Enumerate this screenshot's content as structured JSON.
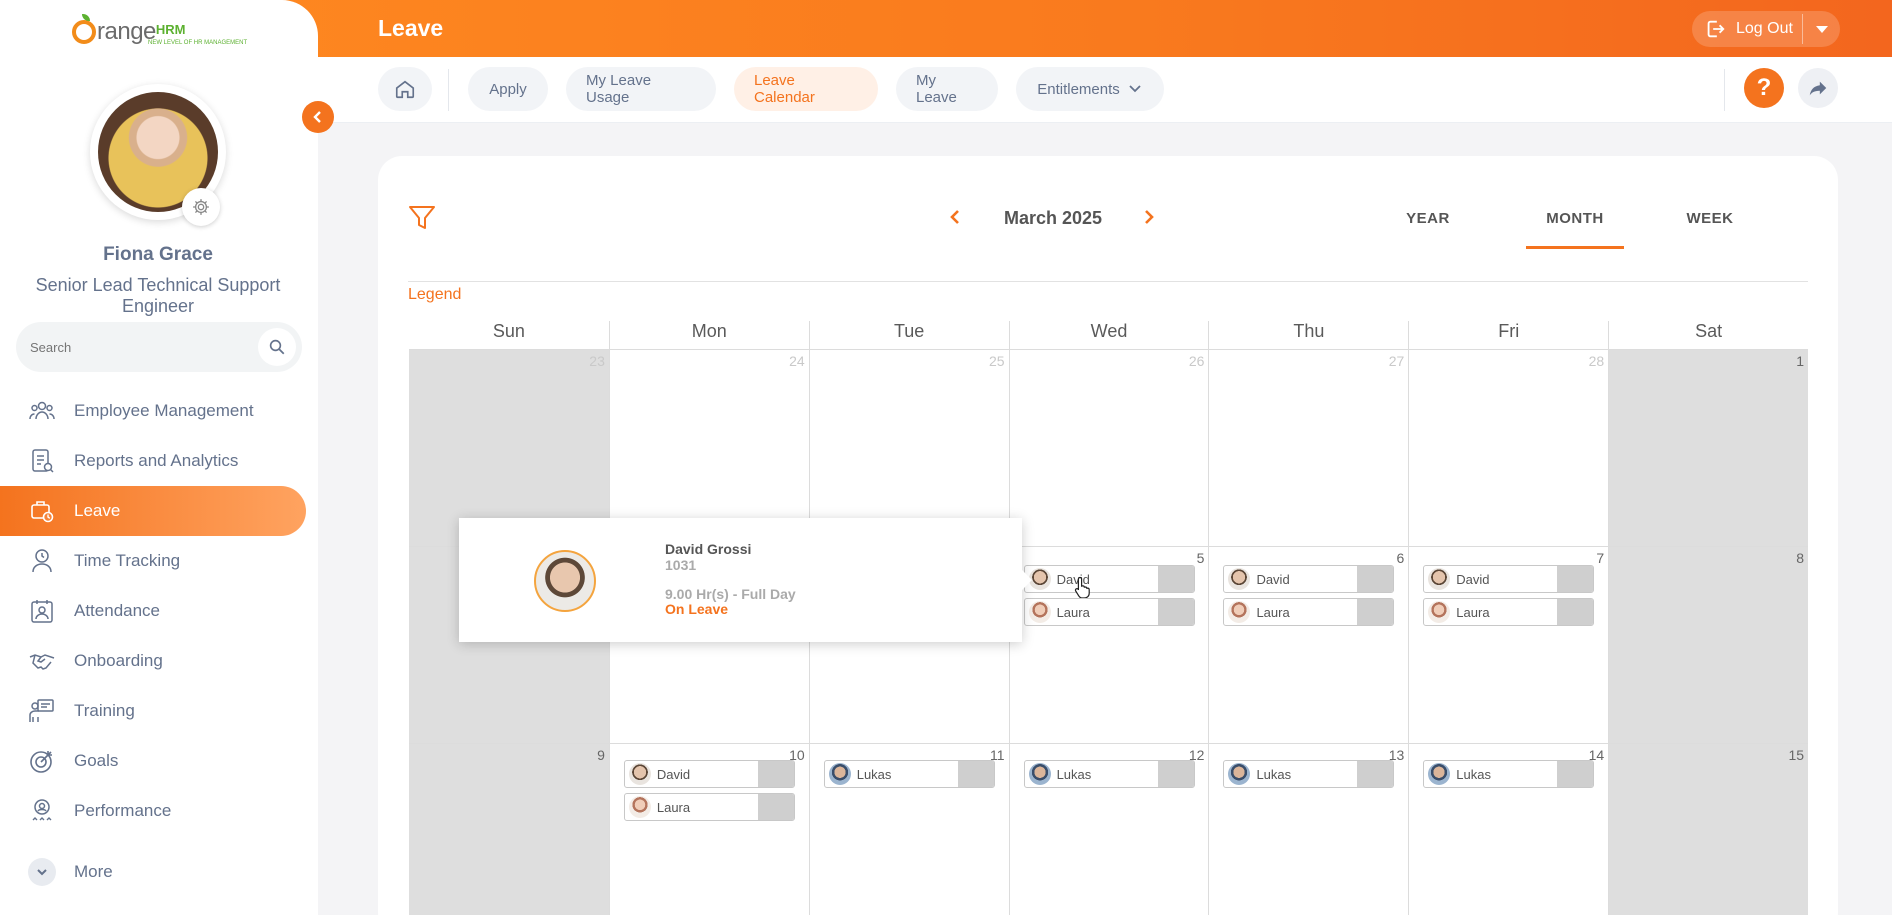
{
  "header": {
    "title": "Leave",
    "logout_label": "Log Out"
  },
  "brand": {
    "logo_text": "range",
    "logo_hrm": "HRM",
    "tagline": "NEW LEVEL OF HR MANAGEMENT"
  },
  "user": {
    "name": "Fiona Grace",
    "title": "Senior Lead Technical Support Engineer"
  },
  "search": {
    "placeholder": "Search"
  },
  "sidebar": {
    "items": [
      {
        "label": "Employee Management",
        "icon": "people-icon"
      },
      {
        "label": "Reports and Analytics",
        "icon": "report-icon"
      },
      {
        "label": "Leave",
        "icon": "leave-icon",
        "active": true
      },
      {
        "label": "Time Tracking",
        "icon": "clock-user-icon"
      },
      {
        "label": "Attendance",
        "icon": "attendance-icon"
      },
      {
        "label": "Onboarding",
        "icon": "handshake-icon"
      },
      {
        "label": "Training",
        "icon": "training-icon"
      },
      {
        "label": "Goals",
        "icon": "target-icon"
      },
      {
        "label": "Performance",
        "icon": "award-icon"
      }
    ],
    "more_label": "More"
  },
  "subnav": {
    "apply": "Apply",
    "usage": "My Leave Usage",
    "calendar": "Leave Calendar",
    "my_leave": "My Leave",
    "entitlements": "Entitlements"
  },
  "calendar": {
    "month_label": "March 2025",
    "views": {
      "year": "YEAR",
      "month": "MONTH",
      "week": "WEEK"
    },
    "active_view": "MONTH",
    "legend_label": "Legend",
    "days": [
      "Sun",
      "Mon",
      "Tue",
      "Wed",
      "Thu",
      "Fri",
      "Sat"
    ],
    "week1": [
      "23",
      "24",
      "25",
      "26",
      "27",
      "28",
      "1"
    ],
    "week2": [
      "",
      "",
      "",
      "5",
      "6",
      "7",
      "8"
    ],
    "week3": [
      "9",
      "10",
      "11",
      "12",
      "13",
      "14",
      "15"
    ],
    "entries": {
      "d5": [
        "David",
        "Laura"
      ],
      "d6": [
        "David",
        "Laura"
      ],
      "d7": [
        "David",
        "Laura"
      ],
      "d10": [
        "David",
        "Laura"
      ],
      "d11": [
        "Lukas"
      ],
      "d12": [
        "Lukas"
      ],
      "d13": [
        "Lukas"
      ],
      "d14": [
        "Lukas"
      ]
    }
  },
  "tooltip": {
    "name": "David Grossi",
    "employee_id": "1031",
    "hours": "9.00 Hr(s) - Full Day",
    "status": "On Leave"
  },
  "colors": {
    "accent": "#f4731e",
    "weekend": "#dedede",
    "text_muted": "#64728c"
  }
}
